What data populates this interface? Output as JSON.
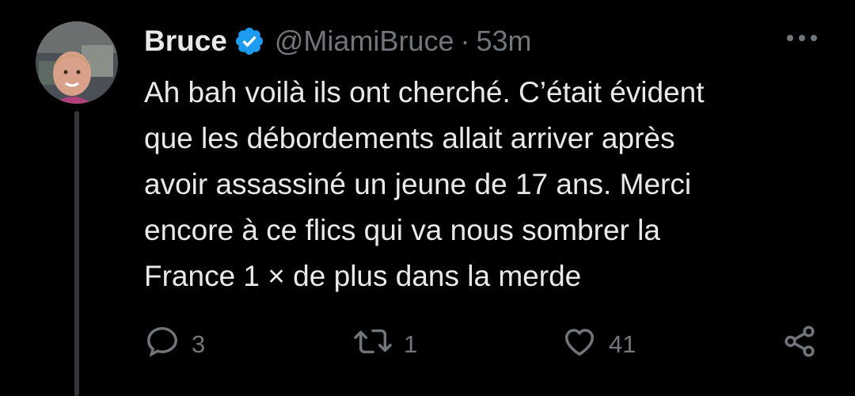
{
  "tweet": {
    "display_name": "Bruce",
    "handle": "@MiamiBruce",
    "separator": "·",
    "time": "53m",
    "verified": true,
    "text": "Ah bah voilà ils ont cherché. C’était évident\nque les débordements allait arriver après\navoir assassiné un jeune de 17 ans. Merci\nencore à ce flics qui va nous sombrer la\nFrance 1 × de plus dans la merde",
    "replies": "3",
    "retweets": "1",
    "likes": "41"
  },
  "colors": {
    "background": "#000000",
    "text": "#e7e9ea",
    "muted": "#71767b",
    "verified": "#1d9bf0",
    "thread_line": "#333639"
  },
  "icons": {
    "avatar": "avatar",
    "verified": "verified-badge-icon",
    "more": "more-options-icon",
    "reply": "reply-icon",
    "retweet": "retweet-icon",
    "like": "heart-icon",
    "share": "share-icon"
  }
}
